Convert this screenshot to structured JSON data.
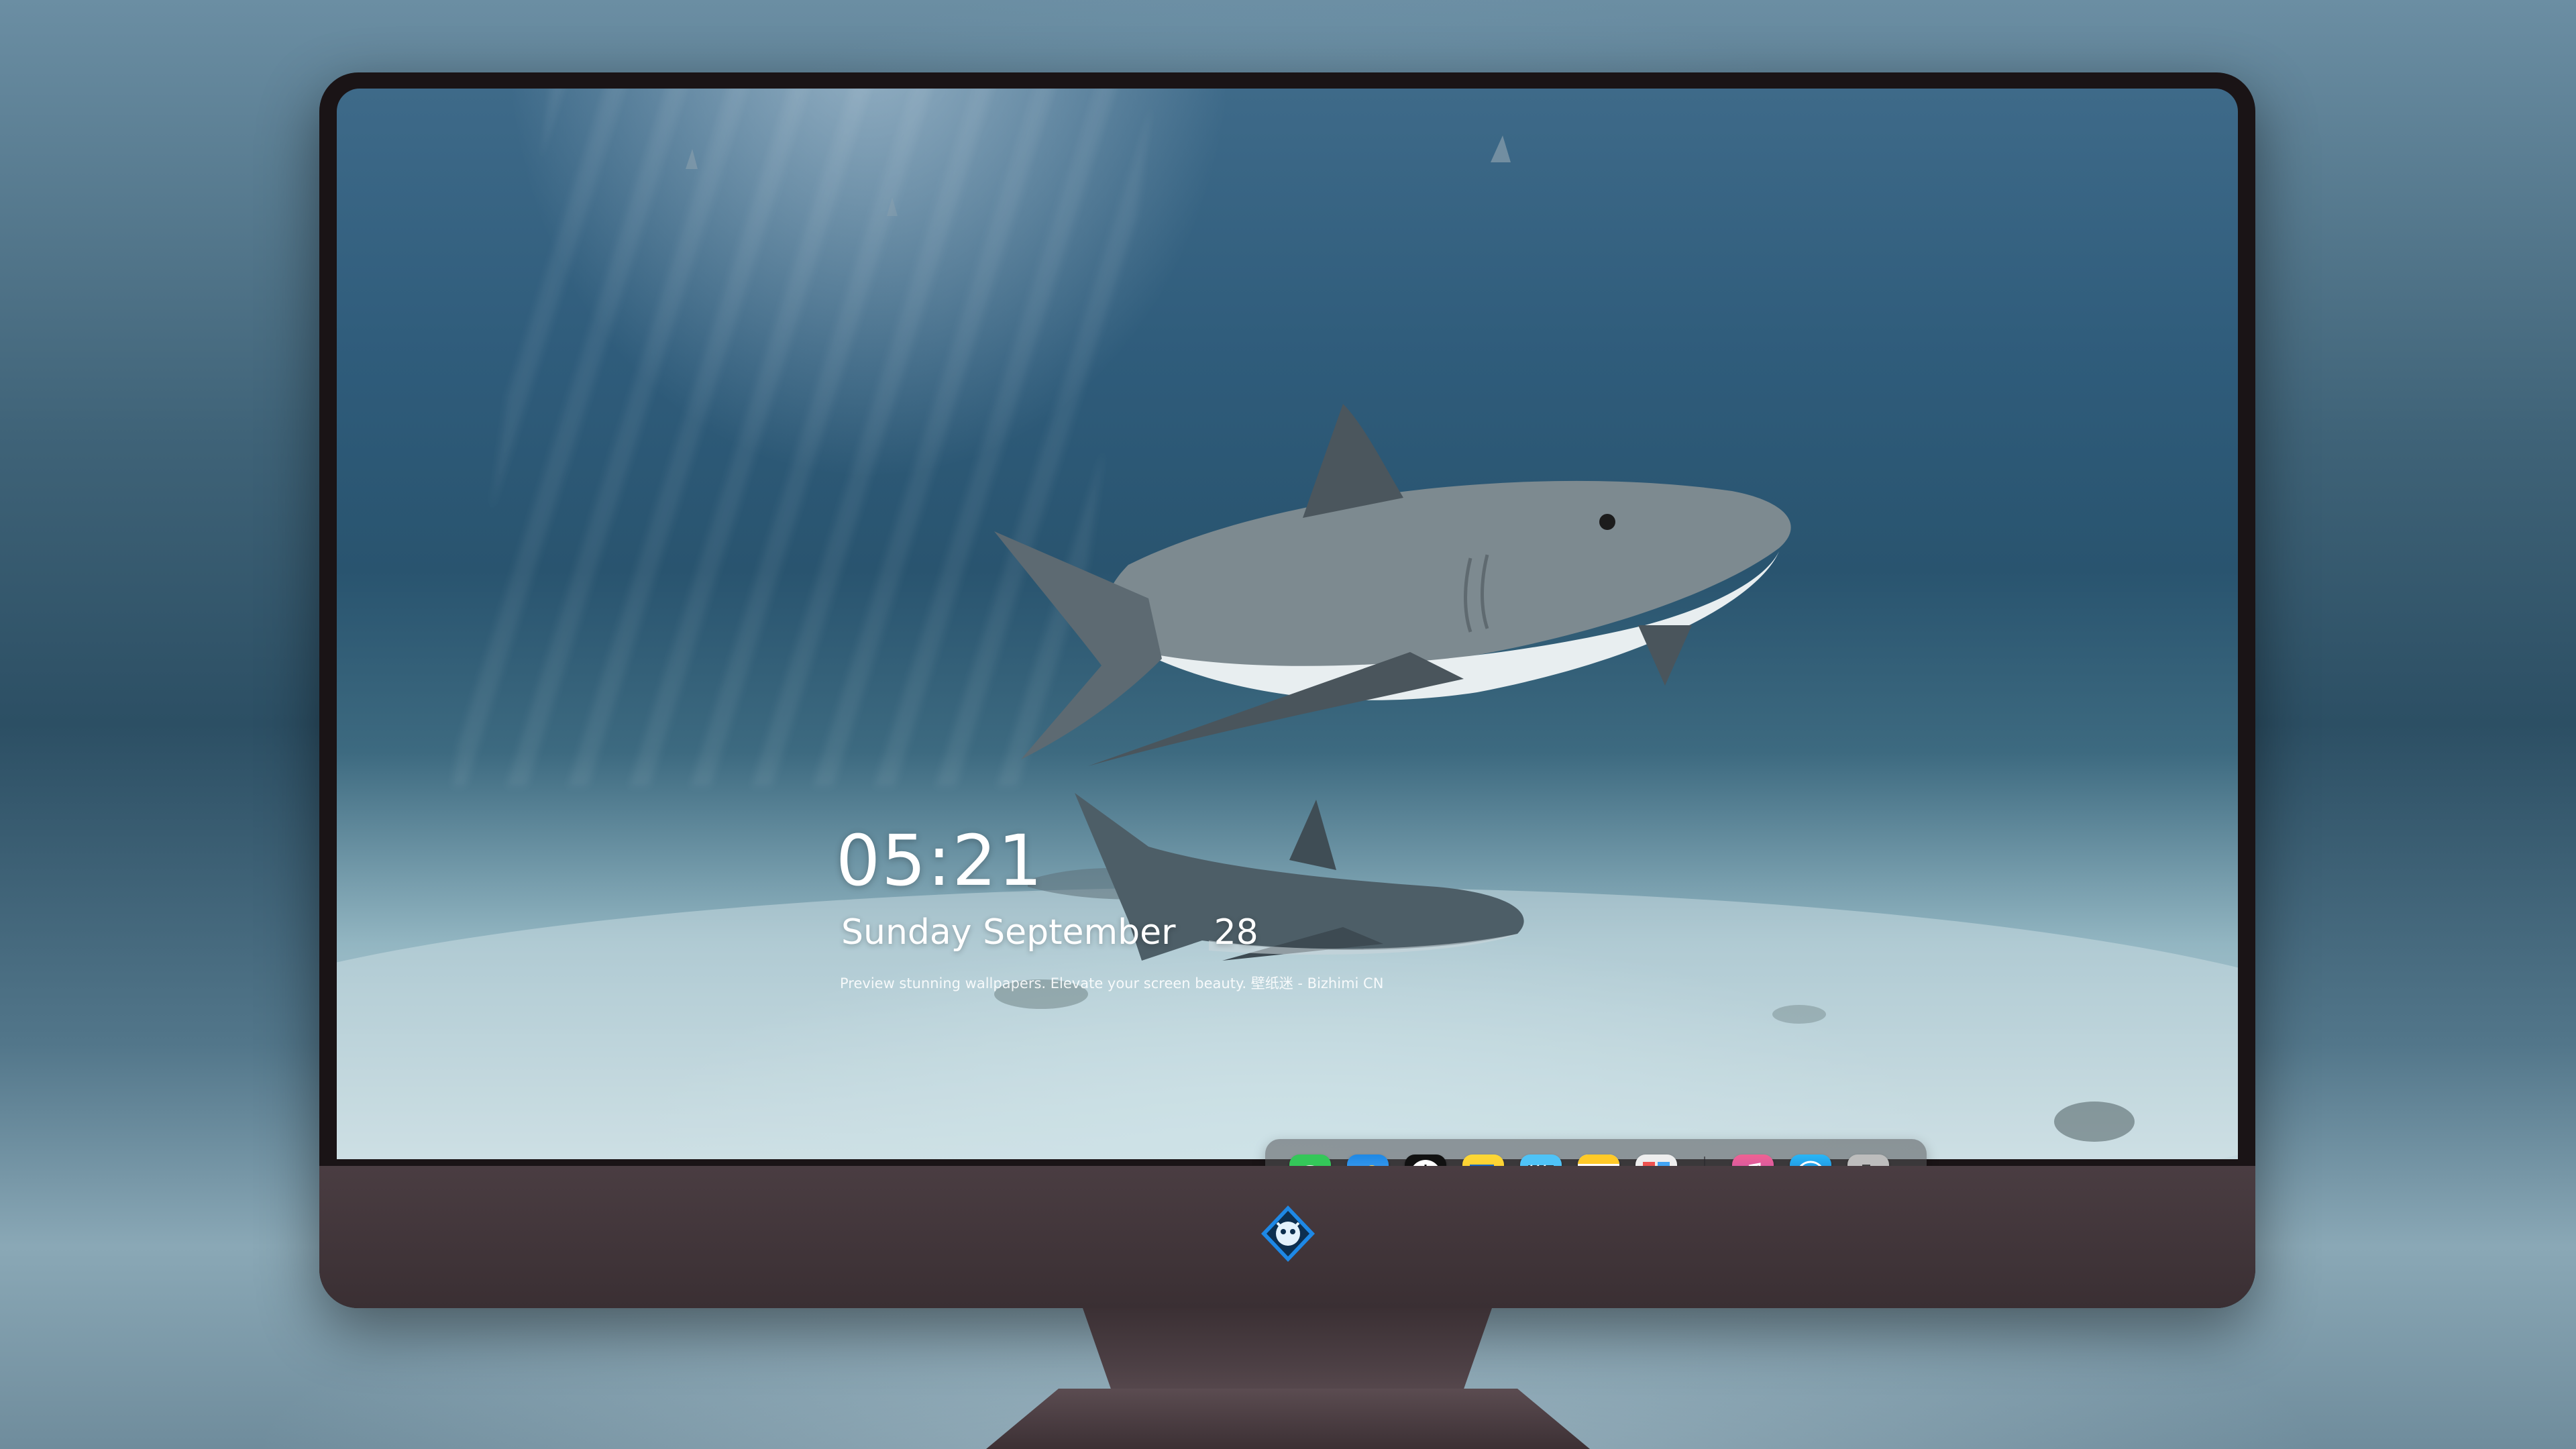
{
  "lock_screen": {
    "time": "05:21",
    "weekday": "Sunday",
    "month": "September",
    "day": "28",
    "tagline": "Preview stunning wallpapers. Elevate your screen beauty. 壁纸迷 - Bizhimi CN"
  },
  "dock": {
    "apps": [
      {
        "name": "messages-icon"
      },
      {
        "name": "weather-icon"
      },
      {
        "name": "clock-icon"
      },
      {
        "name": "preview-icon"
      },
      {
        "name": "clapper-icon"
      },
      {
        "name": "notes-icon"
      },
      {
        "name": "photo-booth-icon"
      }
    ],
    "right_apps": [
      {
        "name": "music-icon"
      },
      {
        "name": "app-store-icon"
      },
      {
        "name": "camera-icon"
      }
    ]
  },
  "colors": {
    "monitor_bezel": "#1a1416",
    "monitor_chin": "#4a3d42",
    "text": "#ffffff"
  },
  "wallpaper": {
    "subject": "reef sharks over sandy seabed"
  }
}
